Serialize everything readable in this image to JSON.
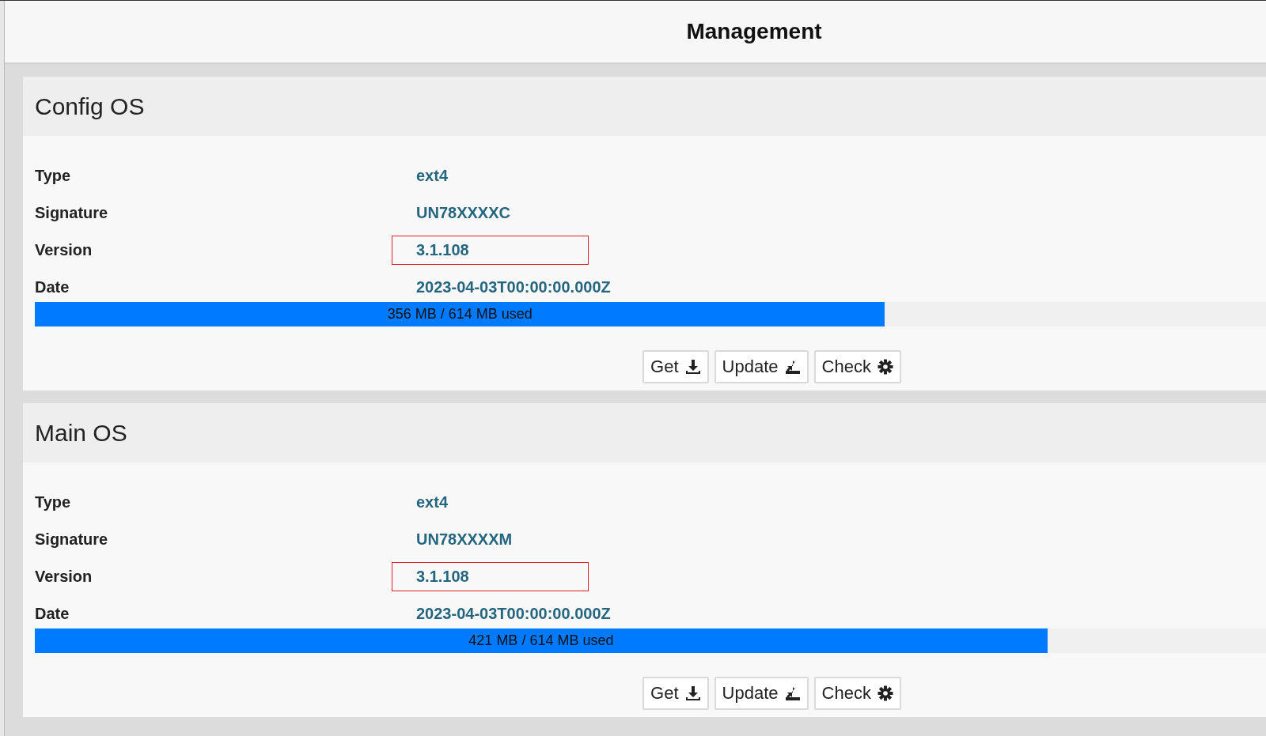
{
  "header": {
    "title": "Management"
  },
  "sections": [
    {
      "title": "Config OS",
      "rows": [
        {
          "label": "Type",
          "value": "ext4",
          "highlighted": false
        },
        {
          "label": "Signature",
          "value": "UN78XXXXC",
          "highlighted": false
        },
        {
          "label": "Version",
          "value": "3.1.108",
          "highlighted": true
        },
        {
          "label": "Date",
          "value": "2023-04-03T00:00:00.000Z",
          "highlighted": false
        }
      ],
      "usage": {
        "level": 0.68,
        "reading": "356 MB / 614 MB used"
      },
      "buttons": [
        {
          "label": "Get",
          "kind": "download"
        },
        {
          "label": "Update",
          "kind": "update"
        },
        {
          "label": "Check",
          "kind": "gear"
        }
      ]
    },
    {
      "title": "Main OS",
      "rows": [
        {
          "label": "Type",
          "value": "ext4",
          "highlighted": false
        },
        {
          "label": "Signature",
          "value": "UN78XXXXM",
          "highlighted": false
        },
        {
          "label": "Version",
          "value": "3.1.108",
          "highlighted": true
        },
        {
          "label": "Date",
          "value": "2023-04-03T00:00:00.000Z",
          "highlighted": false
        }
      ],
      "usage": {
        "level": 0.81,
        "reading": "421 MB / 614 MB used"
      },
      "buttons": [
        {
          "label": "Get",
          "kind": "download"
        },
        {
          "label": "Update",
          "kind": "update"
        },
        {
          "label": "Check",
          "kind": "gear"
        }
      ]
    }
  ]
}
